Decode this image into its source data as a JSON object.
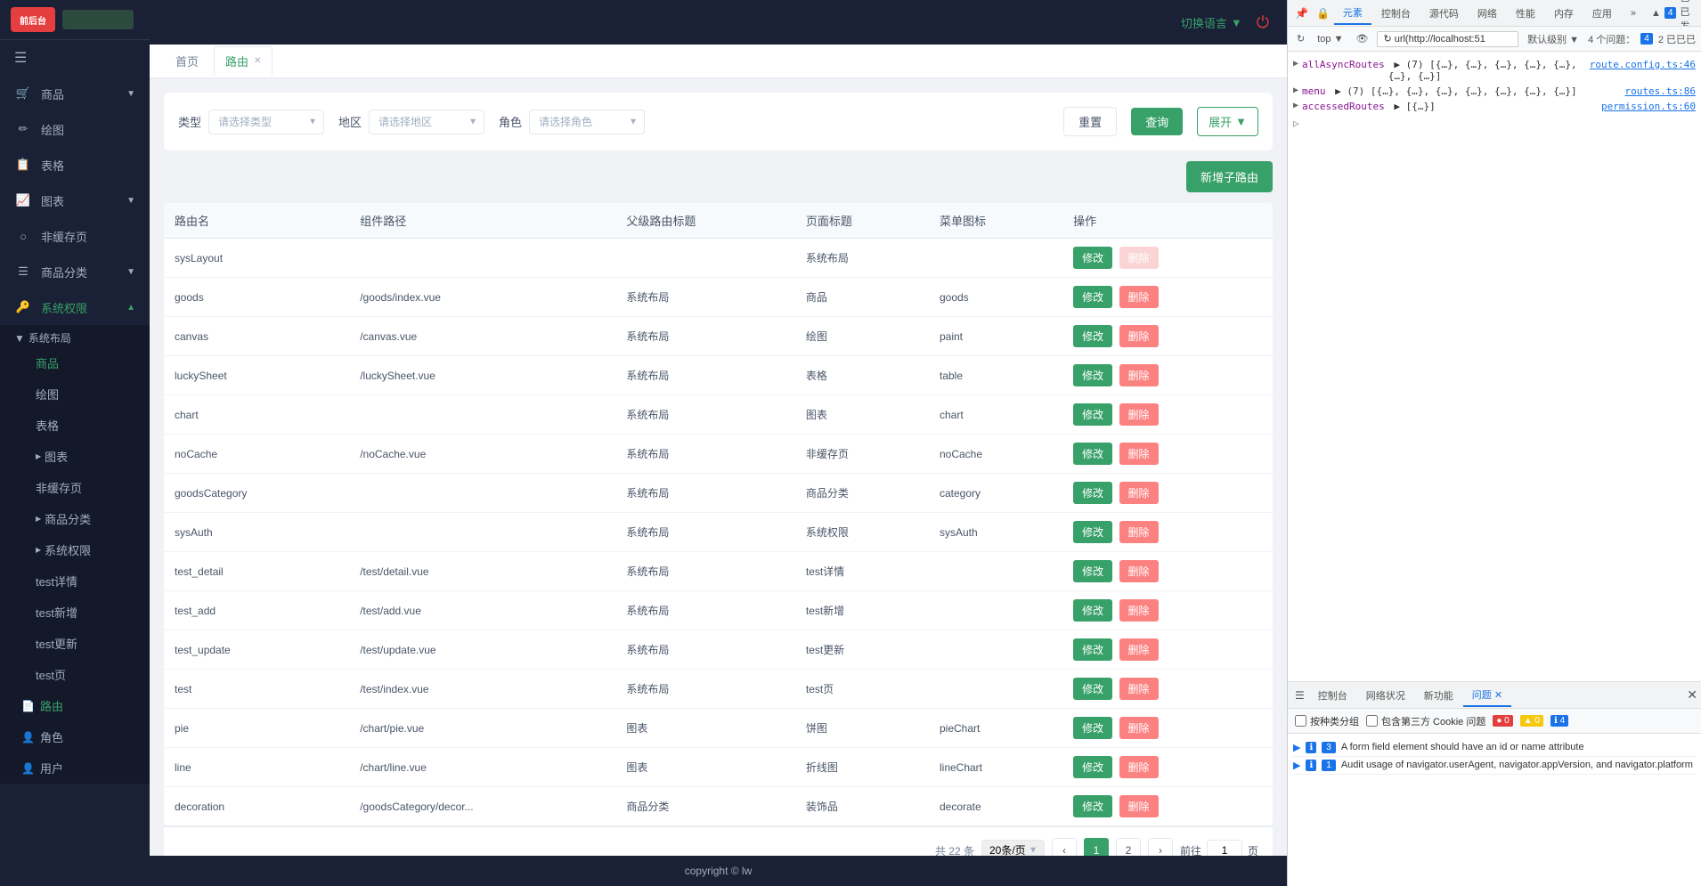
{
  "app": {
    "logo_text": "前后台",
    "logo_sub": "",
    "url": "127.0.0.1:5173/sysAuth/route"
  },
  "topbar": {
    "lang_label": "切换语言",
    "power_icon": "⏻"
  },
  "sidebar": {
    "menu_icon": "☰",
    "items": [
      {
        "id": "goods",
        "label": "商品",
        "icon": "🛒",
        "has_arrow": true,
        "active": false
      },
      {
        "id": "canvas",
        "label": "绘图",
        "icon": "🖊",
        "has_arrow": false,
        "active": false
      },
      {
        "id": "table",
        "label": "表格",
        "icon": "📊",
        "has_arrow": false,
        "active": false
      },
      {
        "id": "chart",
        "label": "图表",
        "icon": "📈",
        "has_arrow": true,
        "active": false
      },
      {
        "id": "nocache",
        "label": "非缓存页",
        "icon": "○",
        "has_arrow": false,
        "active": false
      },
      {
        "id": "goods-category",
        "label": "商品分类",
        "icon": "☰",
        "has_arrow": true,
        "active": false
      },
      {
        "id": "sysauth",
        "label": "系统权限",
        "icon": "🔑",
        "has_arrow": true,
        "active": true
      }
    ],
    "sysauth_children": [
      {
        "id": "route",
        "label": "路由",
        "active": true
      },
      {
        "id": "role",
        "label": "角色",
        "active": false
      },
      {
        "id": "user",
        "label": "用户",
        "active": false
      }
    ],
    "system_layout_children": [
      {
        "label": "商品",
        "active": false
      },
      {
        "label": "绘图",
        "active": false
      },
      {
        "label": "表格",
        "active": false
      },
      {
        "label": "图表",
        "active": false,
        "has_dot": true
      },
      {
        "label": "非缓存页",
        "active": false
      },
      {
        "label": "商品分类",
        "active": false,
        "has_dot": true
      },
      {
        "label": "系统权限",
        "active": false,
        "has_dot": true
      },
      {
        "label": "test详情",
        "active": false
      },
      {
        "label": "test新增",
        "active": false
      },
      {
        "label": "test更新",
        "active": false
      },
      {
        "label": "test页",
        "active": false
      }
    ]
  },
  "tabs": [
    {
      "id": "home",
      "label": "首页",
      "closable": false,
      "active": false
    },
    {
      "id": "route",
      "label": "路由",
      "closable": true,
      "active": true
    }
  ],
  "filters": {
    "type_label": "类型",
    "type_placeholder": "请选择类型",
    "region_label": "地区",
    "region_placeholder": "请选择地区",
    "role_label": "角色",
    "role_placeholder": "请选择角色",
    "reset_label": "重置",
    "query_label": "查询",
    "expand_label": "展开"
  },
  "actions": {
    "add_child_label": "新增子路由"
  },
  "table": {
    "columns": [
      "路由名",
      "组件路径",
      "父级路由标题",
      "页面标题",
      "菜单图标",
      "操作"
    ],
    "rows": [
      {
        "name": "sysLayout",
        "path": "",
        "parent": "",
        "title": "系统布局",
        "icon": "",
        "modify": "修改",
        "delete": "删除",
        "delete_disabled": true
      },
      {
        "name": "goods",
        "path": "/goods/index.vue",
        "parent": "系统布局",
        "title": "商品",
        "icon": "goods",
        "modify": "修改",
        "delete": "删除",
        "delete_disabled": false
      },
      {
        "name": "canvas",
        "path": "/canvas.vue",
        "parent": "系统布局",
        "title": "绘图",
        "icon": "paint",
        "modify": "修改",
        "delete": "删除",
        "delete_disabled": false
      },
      {
        "name": "luckySheet",
        "path": "/luckySheet.vue",
        "parent": "系统布局",
        "title": "表格",
        "icon": "table",
        "modify": "修改",
        "delete": "删除",
        "delete_disabled": false
      },
      {
        "name": "chart",
        "path": "",
        "parent": "系统布局",
        "title": "图表",
        "icon": "chart",
        "modify": "修改",
        "delete": "删除",
        "delete_disabled": false
      },
      {
        "name": "noCache",
        "path": "/noCache.vue",
        "parent": "系统布局",
        "title": "非缓存页",
        "icon": "noCache",
        "modify": "修改",
        "delete": "删除",
        "delete_disabled": false
      },
      {
        "name": "goodsCategory",
        "path": "",
        "parent": "系统布局",
        "title": "商品分类",
        "icon": "category",
        "modify": "修改",
        "delete": "删除",
        "delete_disabled": false
      },
      {
        "name": "sysAuth",
        "path": "",
        "parent": "系统布局",
        "title": "系统权限",
        "icon": "sysAuth",
        "modify": "修改",
        "delete": "删除",
        "delete_disabled": false
      },
      {
        "name": "test_detail",
        "path": "/test/detail.vue",
        "parent": "系统布局",
        "title": "test详情",
        "icon": "",
        "modify": "修改",
        "delete": "删除",
        "delete_disabled": false
      },
      {
        "name": "test_add",
        "path": "/test/add.vue",
        "parent": "系统布局",
        "title": "test新增",
        "icon": "",
        "modify": "修改",
        "delete": "删除",
        "delete_disabled": false
      },
      {
        "name": "test_update",
        "path": "/test/update.vue",
        "parent": "系统布局",
        "title": "test更新",
        "icon": "",
        "modify": "修改",
        "delete": "删除",
        "delete_disabled": false
      },
      {
        "name": "test",
        "path": "/test/index.vue",
        "parent": "系统布局",
        "title": "test页",
        "icon": "",
        "modify": "修改",
        "delete": "删除",
        "delete_disabled": false
      },
      {
        "name": "pie",
        "path": "/chart/pie.vue",
        "parent": "图表",
        "title": "饼图",
        "icon": "pieChart",
        "modify": "修改",
        "delete": "删除",
        "delete_disabled": false
      },
      {
        "name": "line",
        "path": "/chart/line.vue",
        "parent": "图表",
        "title": "折线图",
        "icon": "lineChart",
        "modify": "修改",
        "delete": "删除",
        "delete_disabled": false
      },
      {
        "name": "decoration",
        "path": "/goodsCategory/decor...",
        "parent": "商品分类",
        "title": "装饰品",
        "icon": "decorate",
        "modify": "修改",
        "delete": "删除",
        "delete_disabled": false
      }
    ]
  },
  "pagination": {
    "total_prefix": "共",
    "total_count": "22",
    "total_suffix": "条",
    "page_size": "20条/页",
    "current_page": 1,
    "total_pages": 2,
    "prev_icon": "‹",
    "next_icon": "›",
    "go_prefix": "前往",
    "go_page": "1",
    "go_suffix": "页"
  },
  "footer": {
    "text": "copyright © lw"
  },
  "devtools": {
    "tabs": [
      "元素",
      "控制台",
      "源代码",
      "网络",
      "性能",
      "内存",
      "应用",
      "»"
    ],
    "active_tab": "元素",
    "icons": [
      "📌",
      "🔒",
      "▶",
      "📵",
      "↑"
    ],
    "toolbar": {
      "top_label": "top",
      "url_value": "↻ url(http://localhost:51",
      "level_label": "默认级别",
      "issue_label": "4个问题："
    },
    "lines": [
      {
        "arrow": "▶",
        "key": "allAsyncRoutes",
        "val": "▶ (7) [{…}, {…}, {…}, {…}, {…}, {…}, {…}]",
        "link": "route.config.ts:46"
      },
      {
        "arrow": "▶",
        "key": "menu",
        "val": "▶ (7) [{…}, {…}, {…}, {…}, {…}, {…}, {…}]",
        "link": "routes.ts:86"
      },
      {
        "arrow": "▶",
        "key": "accessedRoutes",
        "val": "▶ [{…}]",
        "link": "permission.ts:60"
      }
    ],
    "triangle": "▷"
  },
  "devtools_bottom": {
    "tabs": [
      "控制台",
      "网络状况",
      "新功能",
      "问题"
    ],
    "active_tab": "问题",
    "close_icon": "✕",
    "filter": {
      "checkbox1": "按种类分组",
      "checkbox2": "包含第三方 Cookie 问题",
      "badge_yellow": "▲ 0",
      "badge_red": "● 0",
      "badge_blue": "ℹ 4"
    },
    "issues": [
      {
        "type": "blue",
        "icon": "ℹ",
        "count": "3",
        "text": "A form field element should have an id or name attribute",
        "link": ""
      },
      {
        "type": "blue",
        "icon": "ℹ",
        "count": "1",
        "text": "Audit usage of navigator.userAgent, navigator.appVersion, and navigator.platform",
        "link": ""
      }
    ]
  }
}
